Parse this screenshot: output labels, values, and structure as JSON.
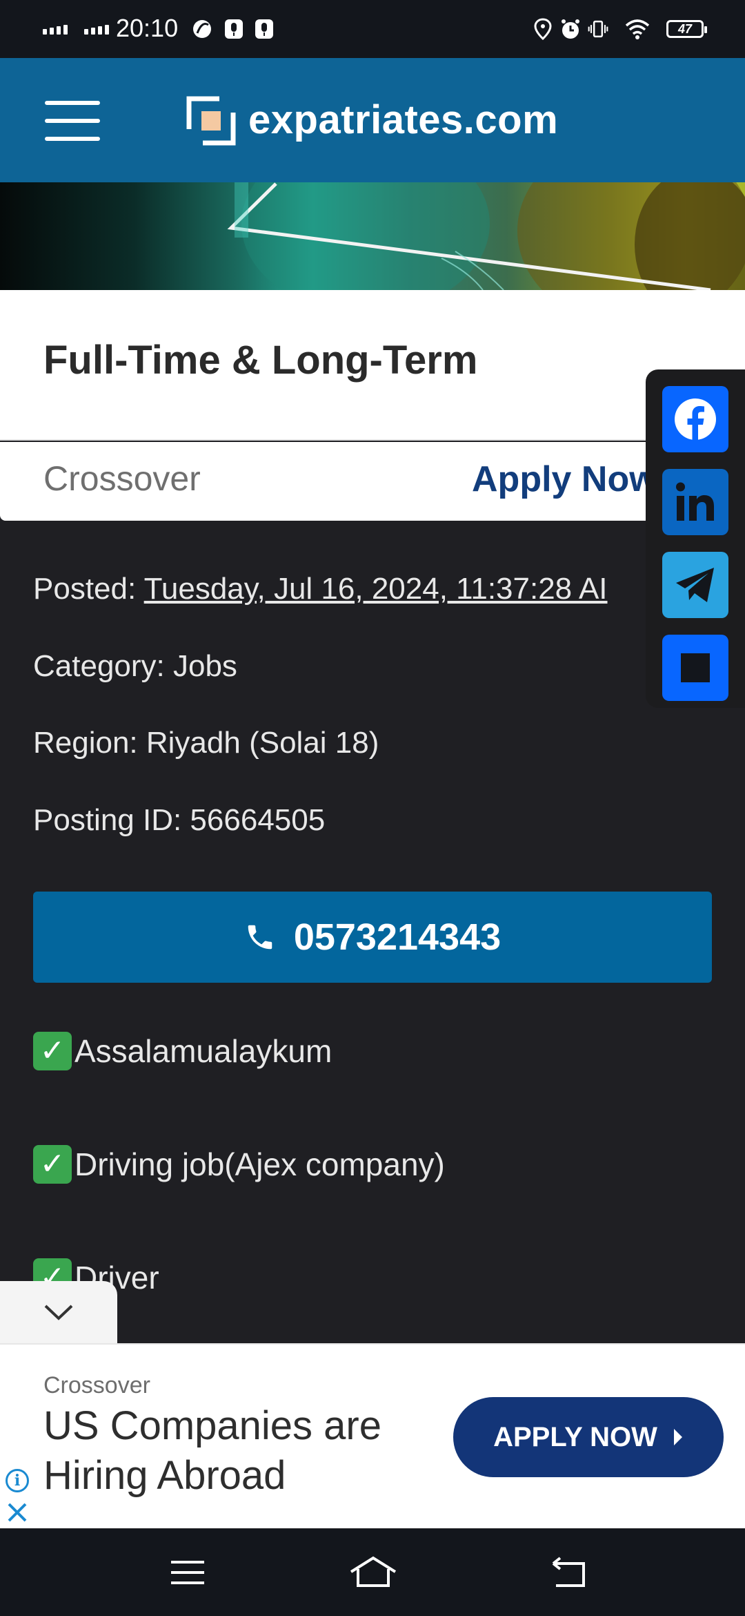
{
  "status_bar": {
    "time": "20:10",
    "battery": "47",
    "icons": [
      "signal-icon",
      "signal-icon",
      "app-notification-icon",
      "mic-icon",
      "mic-icon",
      "location-icon",
      "alarm-icon",
      "vibrate-icon",
      "wifi-icon",
      "battery-icon"
    ]
  },
  "header": {
    "site_name": "expatriates.com",
    "menu_icon": "hamburger-menu-icon"
  },
  "job": {
    "title": "Full-Time & Long-Term",
    "company": "Crossover",
    "apply_label": "Apply Now"
  },
  "details": {
    "posted_label": "Posted: ",
    "posted_date": "Tuesday, Jul 16, 2024, 11:37:28 AI",
    "category": "Category: Jobs",
    "region": "Region: Riyadh (Solai 18)",
    "posting_id": "Posting ID: 56664505"
  },
  "phone": {
    "number": "0573214343",
    "icon": "phone-icon"
  },
  "body_lines": [
    "Assalamualaykum",
    "Driving job(Ajex company)",
    " Driver"
  ],
  "share": {
    "items": [
      "facebook-icon",
      "linkedin-icon",
      "telegram-icon",
      "share-more-icon"
    ],
    "colors": {
      "facebook": "#0866ff",
      "linkedin": "#0a66c2",
      "telegram": "#2aa3e0",
      "more": "#0866ff"
    }
  },
  "ad": {
    "brand": "Crossover",
    "headline": "US Companies are Hiring Abroad",
    "cta": "APPLY NOW"
  },
  "colors": {
    "header_bg": "#0e6496",
    "phone_button": "#03669d",
    "ad_cta": "#133578",
    "page_bg": "#1f1f23"
  }
}
